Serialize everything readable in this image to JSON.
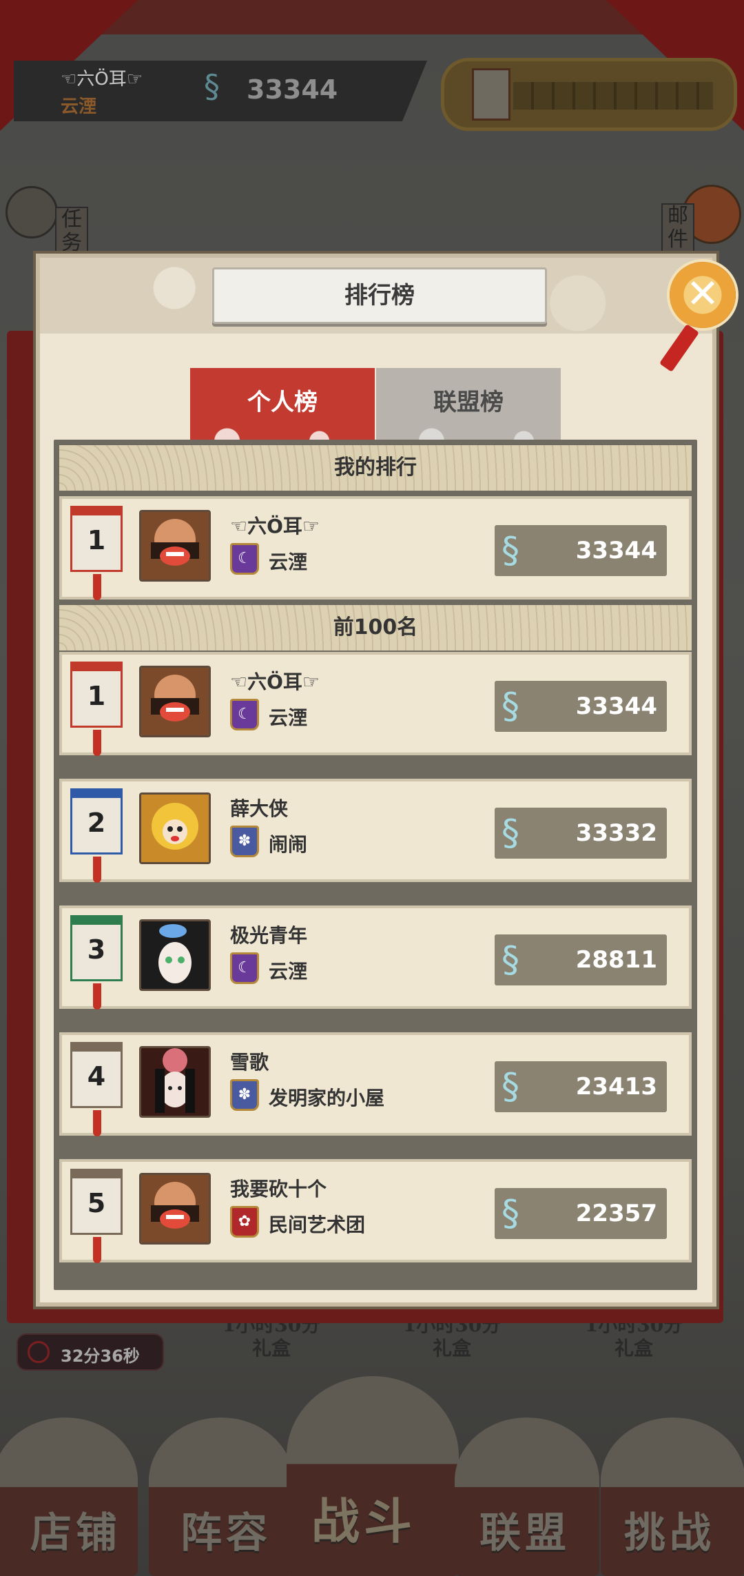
{
  "top_bar": {
    "player_name": "☜六Ö耳☞",
    "guild_name": "云湮",
    "currency_icon": "seahorse-icon",
    "currency_value": "33344"
  },
  "side_buttons": {
    "task_label": "任务",
    "mail_label": "邮件"
  },
  "modal": {
    "title": "排行榜",
    "tabs": [
      {
        "label": "个人榜",
        "active": true
      },
      {
        "label": "联盟榜",
        "active": false
      }
    ],
    "my_rank_header": "我的排行",
    "top100_header": "前100名",
    "my_rank": {
      "rank": "1",
      "name": "☜六Ö耳☞",
      "guild": "云湮",
      "guild_icon": "moon-emblem-icon",
      "score": "33344"
    },
    "top100": [
      {
        "rank": "1",
        "name": "☜六Ö耳☞",
        "guild": "云湮",
        "guild_icon": "moon-emblem-icon",
        "score": "33344",
        "badge_color": "#c0392b"
      },
      {
        "rank": "2",
        "name": "薛大侠",
        "guild": "闹闹",
        "guild_icon": "paw-emblem-icon",
        "score": "33332",
        "badge_color": "#2f5aa8"
      },
      {
        "rank": "3",
        "name": "极光青年",
        "guild": "云湮",
        "guild_icon": "moon-emblem-icon",
        "score": "28811",
        "badge_color": "#2e7d4f"
      },
      {
        "rank": "4",
        "name": "雪歌",
        "guild": "发明家的小屋",
        "guild_icon": "paw-emblem-icon",
        "score": "23413",
        "badge_color": "#7a6a5a"
      },
      {
        "rank": "5",
        "name": "我要砍十个",
        "guild": "民间艺术团",
        "guild_icon": "flower-emblem-icon",
        "score": "22357",
        "badge_color": "#7a6a5a"
      }
    ]
  },
  "bottom": {
    "timer": "32分36秒",
    "gifts": [
      {
        "line1": "1小时30分",
        "line2": "礼盒"
      },
      {
        "line1": "1小时30分",
        "line2": "礼盒"
      },
      {
        "line1": "1小时30分",
        "line2": "礼盒"
      }
    ],
    "nav": [
      "店铺",
      "阵容",
      "战斗",
      "联盟",
      "挑战"
    ]
  },
  "colors": {
    "accent_red": "#c23a30",
    "score_box": "#8b8371",
    "parchment": "#efe7d2"
  }
}
